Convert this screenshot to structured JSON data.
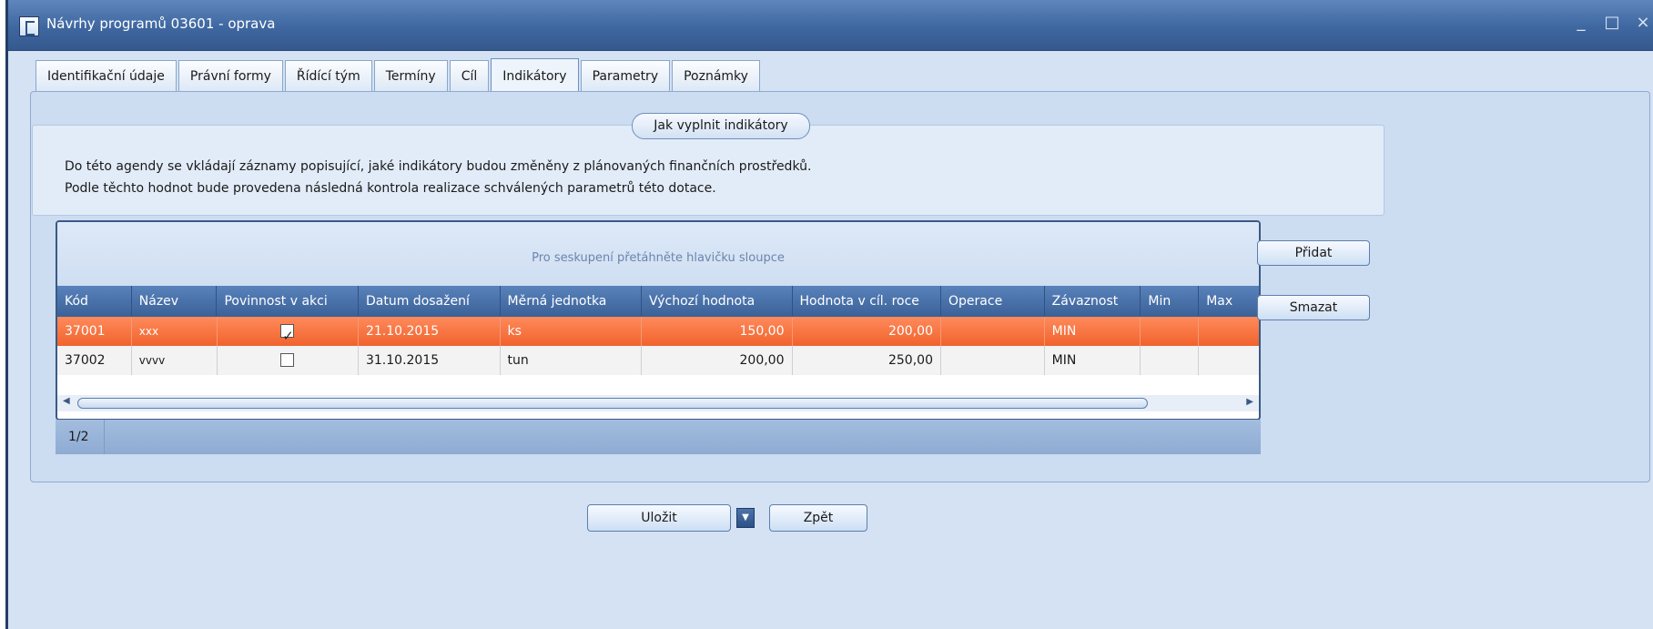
{
  "window": {
    "title": "Návrhy programů 03601 - oprava",
    "app_icon": "document-icon",
    "controls": {
      "minimize": "_",
      "maximize": "□",
      "close": "×"
    }
  },
  "tabs": [
    {
      "label": "Identifikační údaje",
      "active": false
    },
    {
      "label": "Právní formy",
      "active": false
    },
    {
      "label": "Řídící tým",
      "active": false
    },
    {
      "label": "Termíny",
      "active": false
    },
    {
      "label": "Cíl",
      "active": false
    },
    {
      "label": "Indikátory",
      "active": true
    },
    {
      "label": "Parametry",
      "active": false
    },
    {
      "label": "Poznámky",
      "active": false
    }
  ],
  "info": {
    "help_button": "Jak vyplnit indikátory",
    "line1": "Do této agendy se vkládají záznamy popisující, jaké indikátory budou změněny z plánovaných finančních prostředků.",
    "line2": "Podle těchto hodnot bude provedena následná kontrola realizace schválených parametrů této dotace."
  },
  "grid": {
    "group_hint": "Pro seskupení přetáhněte hlavičku sloupce",
    "columns": [
      "Kód",
      "Název",
      "Povinnost v akci",
      "Datum dosažení",
      "Měrná jednotka",
      "Výchozí hodnota",
      "Hodnota v cíl. roce",
      "Operace",
      "Závaznost",
      "Min",
      "Max"
    ],
    "rows": [
      {
        "kod": "37001",
        "nazev": "xxx",
        "povinnost": true,
        "datum": "21.10.2015",
        "jednotka": "ks",
        "vychozi": "150,00",
        "cilova": "200,00",
        "operace": "",
        "zavaznost": "MIN",
        "min": "",
        "max": "",
        "selected": true
      },
      {
        "kod": "37002",
        "nazev": "vvvv",
        "povinnost": false,
        "datum": "31.10.2015",
        "jednotka": "tun",
        "vychozi": "200,00",
        "cilova": "250,00",
        "operace": "",
        "zavaznost": "MIN",
        "min": "",
        "max": "",
        "selected": false
      }
    ],
    "pager": "1/2"
  },
  "side_buttons": {
    "add": "Přidat",
    "delete": "Smazat"
  },
  "bottom_buttons": {
    "save": "Uložit",
    "back": "Zpět"
  },
  "colors": {
    "selected_row": "#f0632d",
    "header": "#3a6299",
    "titlebar": "#3f679f"
  }
}
